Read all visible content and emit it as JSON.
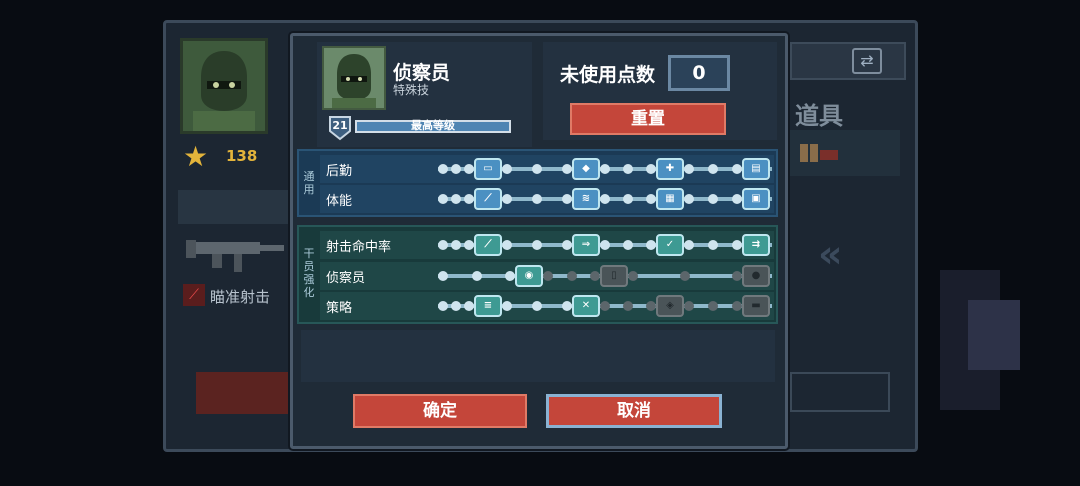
{
  "background": {
    "stars": "138",
    "items_title": "道具",
    "aim_skill": "瞄准射击"
  },
  "character": {
    "name": "侦察员",
    "subtitle": "特殊技",
    "level": "21",
    "level_text": "最高等级",
    "level_progress": 1.0
  },
  "points": {
    "label": "未使用点数",
    "value": "0",
    "reset_label": "重置"
  },
  "groups": [
    {
      "tag": "通用",
      "color": "blue",
      "rows": [
        {
          "label": "后勤",
          "skills": [
            {
              "icon": "ammo-box-icon",
              "glyph": "▭",
              "state": "active"
            },
            {
              "icon": "armor-plus-icon",
              "glyph": "◆",
              "state": "active"
            },
            {
              "icon": "medkit-icon",
              "glyph": "✚",
              "state": "active"
            },
            {
              "icon": "supply-crate-icon",
              "glyph": "▤",
              "state": "active"
            }
          ]
        },
        {
          "label": "体能",
          "skills": [
            {
              "icon": "knife-icon",
              "glyph": "⟋",
              "state": "active"
            },
            {
              "icon": "sprint-icon",
              "glyph": "≋",
              "state": "active"
            },
            {
              "icon": "grid-pack-icon",
              "glyph": "▦",
              "state": "active"
            },
            {
              "icon": "backpack-icon",
              "glyph": "▣",
              "state": "active"
            }
          ]
        }
      ]
    },
    {
      "tag": "干员强化",
      "color": "teal",
      "rows": [
        {
          "label": "射击命中率",
          "skills": [
            {
              "icon": "rifle-up-icon",
              "glyph": "⟋",
              "state": "active"
            },
            {
              "icon": "gun-spread-icon",
              "glyph": "⇒",
              "state": "active"
            },
            {
              "icon": "gun-check-icon",
              "glyph": "✓",
              "state": "active"
            },
            {
              "icon": "rifle-burst-icon",
              "glyph": "⇉",
              "state": "active"
            }
          ]
        },
        {
          "label": "侦察员",
          "skills": [
            {
              "icon": "scope-icon",
              "glyph": "◉",
              "state": "active"
            },
            {
              "icon": "magazine-icon",
              "glyph": "▯",
              "state": "locked"
            },
            {
              "icon": "grenade-up-icon",
              "glyph": "●",
              "state": "locked"
            }
          ]
        },
        {
          "label": "策略",
          "skills": [
            {
              "icon": "stack-plus-icon",
              "glyph": "≡",
              "state": "active"
            },
            {
              "icon": "weapon-swap-icon",
              "glyph": "✕",
              "state": "active"
            },
            {
              "icon": "bandage-icon",
              "glyph": "◈",
              "state": "locked"
            },
            {
              "icon": "lock-box-icon",
              "glyph": "▬",
              "state": "locked"
            }
          ]
        }
      ]
    }
  ],
  "buttons": {
    "ok": "确定",
    "cancel": "取消"
  },
  "colors": {
    "accent_red": "#c4463a",
    "skill_blue": "#4b90c2",
    "skill_teal": "#3e9a93",
    "locked": "#4a5458"
  }
}
